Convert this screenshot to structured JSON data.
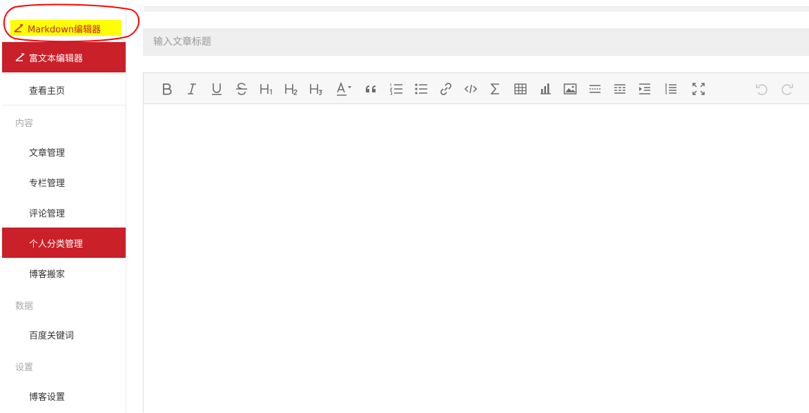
{
  "sidebar": {
    "markdown_editor": "Markdown编辑器",
    "rich_text_editor": "富文本编辑器",
    "view_homepage": "查看主页",
    "groups": {
      "content": "内容",
      "data": "数据",
      "settings": "设置"
    },
    "content_items": [
      "文章管理",
      "专栏管理",
      "评论管理",
      "个人分类管理",
      "博客搬家"
    ],
    "data_items": [
      "百度关键词"
    ],
    "settings_items": [
      "博客设置"
    ],
    "active_item": "个人分类管理",
    "annotation_color": "#ff0000",
    "highlight_color": "#ffff00",
    "accent_color": "#ca2029"
  },
  "editor": {
    "title_placeholder": "输入文章标题",
    "toolbar_icons": [
      "bold-icon",
      "italic-icon",
      "underline-icon",
      "strikethrough-icon",
      "heading1-icon",
      "heading2-icon",
      "heading3-icon",
      "font-color-icon",
      "quote-icon",
      "ordered-list-icon",
      "unordered-list-icon",
      "link-icon",
      "code-icon",
      "formula-icon",
      "table-icon",
      "chart-icon",
      "image-icon",
      "horizontal-rule-icon",
      "page-break-icon",
      "indent-icon",
      "line-numbers-icon",
      "fullscreen-icon",
      "undo-icon",
      "redo-icon"
    ]
  }
}
